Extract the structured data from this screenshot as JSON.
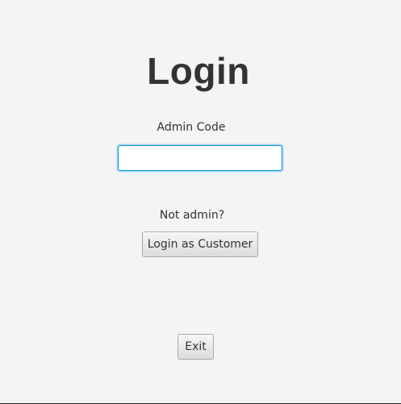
{
  "login": {
    "title": "Login",
    "admin_code_label": "Admin Code",
    "admin_code_value": "",
    "not_admin_text": "Not admin?",
    "customer_button_label": "Login as Customer",
    "exit_button_label": "Exit"
  },
  "colors": {
    "background": "#f4f4f4",
    "focus_ring": "#0a96d8",
    "text": "#333333"
  }
}
